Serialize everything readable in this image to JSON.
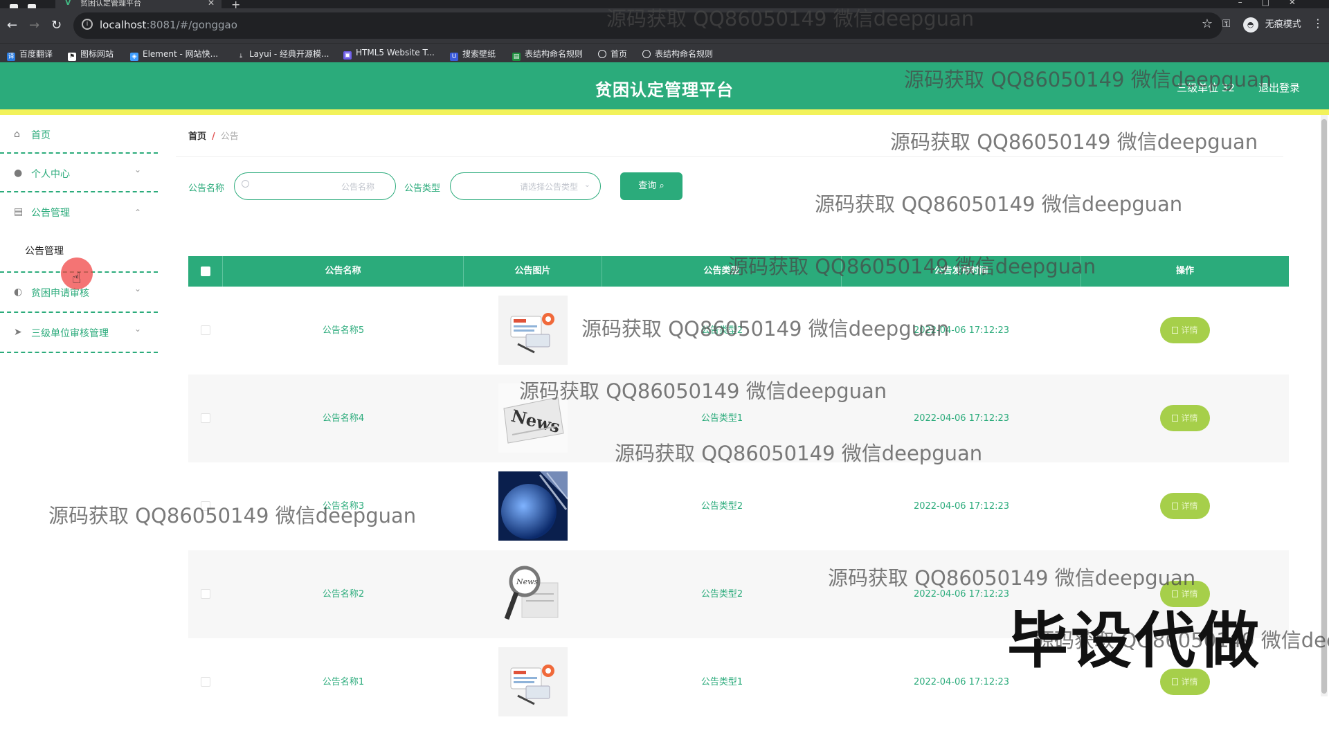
{
  "browser": {
    "tab_title": "贫困认定管理平台",
    "url_host": "localhost",
    "url_rest": ":8081/#/gonggao",
    "profile_label": "无痕模式"
  },
  "bookmarks": [
    {
      "label": "百度翻译",
      "icon": "translate-icon"
    },
    {
      "label": "图标网站",
      "icon": "flag-icon"
    },
    {
      "label": "Element - 网站快...",
      "icon": "element-icon"
    },
    {
      "label": "Layui - 经典开源模...",
      "icon": "layui-icon"
    },
    {
      "label": "HTML5 Website T...",
      "icon": "html5-icon"
    },
    {
      "label": "搜索壁纸",
      "icon": "wallpaper-icon"
    },
    {
      "label": "表结构命名规则",
      "icon": "sheet-icon"
    },
    {
      "label": "首页",
      "icon": "globe-icon"
    },
    {
      "label": "表结构命名规则",
      "icon": "globe-icon"
    }
  ],
  "header": {
    "title": "贫困认定管理平台",
    "user": "三级单位 32",
    "logout": "退出登录"
  },
  "sidebar": {
    "items": [
      {
        "label": "首页",
        "icon": "home-icon"
      },
      {
        "label": "个人中心",
        "icon": "user-icon"
      },
      {
        "label": "公告管理",
        "icon": "notice-icon"
      },
      {
        "label": "贫困申请审核",
        "icon": "apply-icon"
      },
      {
        "label": "三级单位审核管理",
        "icon": "send-icon"
      }
    ],
    "submenu": "公告管理"
  },
  "breadcrumb": {
    "home": "首页",
    "separator": "/",
    "current": "公告"
  },
  "search": {
    "name_label": "公告名称",
    "name_placeholder": "公告名称",
    "type_label": "公告类型",
    "type_placeholder": "请选择公告类型",
    "button": "查询"
  },
  "table": {
    "columns": [
      "公告名称",
      "公告图片",
      "公告类型",
      "公告发布时间",
      "操作"
    ],
    "rows": [
      {
        "name": "公告名称5",
        "type": "公告类型2",
        "time": "2022-04-06 17:12:23",
        "image": "news-laptop"
      },
      {
        "name": "公告名称4",
        "type": "公告类型1",
        "time": "2022-04-06 17:12:23",
        "image": "news-paper"
      },
      {
        "name": "公告名称3",
        "type": "公告类型2",
        "time": "2022-04-06 17:12:23",
        "image": "globe-blue"
      },
      {
        "name": "公告名称2",
        "type": "公告类型2",
        "time": "2022-04-06 17:12:23",
        "image": "news-magnifier"
      },
      {
        "name": "公告名称1",
        "type": "公告类型1",
        "time": "2022-04-06 17:12:23",
        "image": "news-laptop"
      }
    ],
    "detail_label": "详情"
  },
  "watermark": {
    "text": "源码获取 QQ86050149 微信deepguan",
    "big_text": "毕设代做"
  },
  "colors": {
    "primary": "#2bab7b",
    "accent_yellow": "#f2f25a",
    "detail_button": "#a6cf4a",
    "breadcrumb_sep": "#e15656"
  }
}
